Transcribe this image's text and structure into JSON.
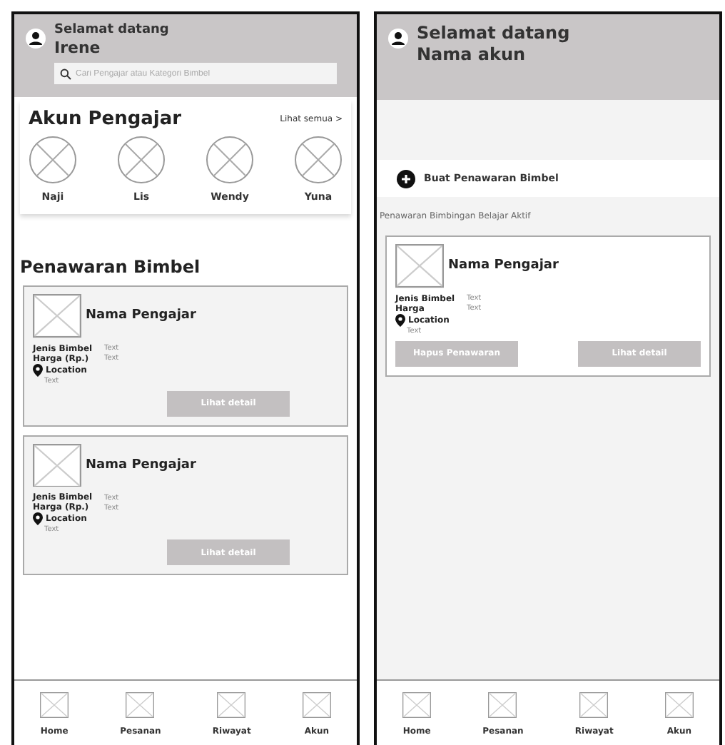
{
  "home_screen": {
    "header": {
      "greeting": "Selamat datang",
      "name": "Irene",
      "search_placeholder": "Cari Pengajar atau Kategori Bimbel"
    },
    "teachers_section": {
      "title": "Akun Pengajar",
      "see_all": "Lihat semua >",
      "teachers": [
        {
          "name": "Naji"
        },
        {
          "name": "Lis"
        },
        {
          "name": "Wendy"
        },
        {
          "name": "Yuna"
        }
      ]
    },
    "offers_title": "Penawaran Bimbel",
    "offers": [
      {
        "teacher_name": "Nama Pengajar",
        "fields": [
          {
            "label": "Jenis Bimbel",
            "value": "Text"
          },
          {
            "label": "Harga (Rp.)",
            "value": "Text"
          }
        ],
        "location_label": "Location",
        "location_value": "Text",
        "buttons": [
          {
            "label": "Lihat detail"
          }
        ]
      },
      {
        "teacher_name": "Nama Pengajar",
        "fields": [
          {
            "label": "Jenis Bimbel",
            "value": "Text"
          },
          {
            "label": "Harga (Rp.)",
            "value": "Text"
          }
        ],
        "location_label": "Location",
        "location_value": "Text",
        "buttons": [
          {
            "label": "Lihat detail"
          }
        ]
      }
    ],
    "nav": [
      {
        "label": "Home"
      },
      {
        "label": "Pesanan"
      },
      {
        "label": "Riwayat"
      },
      {
        "label": "Akun"
      }
    ]
  },
  "offers_screen": {
    "header": {
      "greeting": "Selamat datang",
      "name": "Nama akun"
    },
    "create_button": "Buat Penawaran Bimbel",
    "active_title": "Penawaran Bimbingan Belajar Aktif",
    "offers": [
      {
        "teacher_name": "Nama Pengajar",
        "fields": [
          {
            "label": "Jenis Bimbel",
            "value": "Text"
          },
          {
            "label": "Harga",
            "value": "Text"
          }
        ],
        "location_label": "Location",
        "location_value": "Text",
        "buttons": [
          {
            "label": "Hapus Penawaran"
          },
          {
            "label": "Lihat detail"
          }
        ]
      }
    ],
    "nav": [
      {
        "label": "Home"
      },
      {
        "label": "Pesanan"
      },
      {
        "label": "Riwayat"
      },
      {
        "label": "Akun"
      }
    ]
  }
}
